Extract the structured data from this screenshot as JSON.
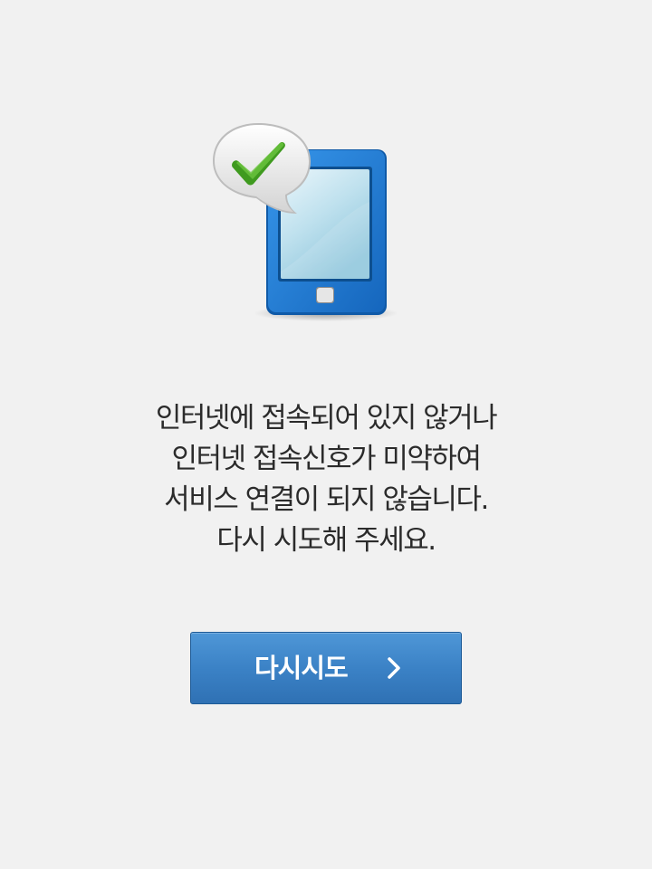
{
  "message": {
    "lines": [
      "인터넷에 접속되어 있지 않거나",
      "인터넷 접속신호가 미약하여",
      "서비스 연결이 되지 않습니다.",
      "다시 시도해 주세요."
    ]
  },
  "retry_button": {
    "label": "다시시도",
    "icon": "chevron-right-icon"
  },
  "illustration": {
    "device_icon": "tablet-icon",
    "badge_icon": "checkmark-icon",
    "device_color": "#1e78d0",
    "check_color": "#45a524"
  },
  "colors": {
    "background": "#f1f1f1",
    "text": "#2b2b2b",
    "button": "#3b82c6",
    "button_text": "#ffffff"
  }
}
